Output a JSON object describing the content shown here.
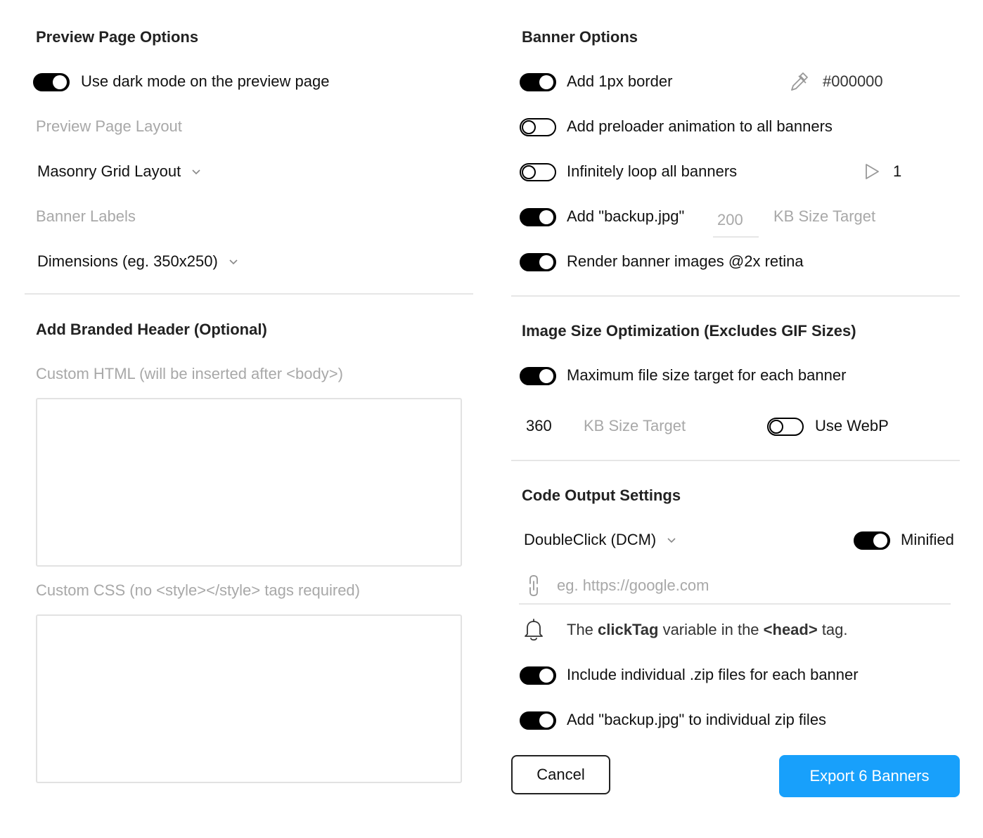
{
  "accent_color": "#18a0fb",
  "preview_page": {
    "title": "Preview Page Options",
    "dark_mode_label": "Use dark mode on the preview page",
    "dark_mode_on": true,
    "layout_label": "Preview Page Layout",
    "layout_value": "Masonry Grid Layout",
    "banner_labels_label": "Banner Labels",
    "banner_labels_value": "Dimensions (eg. 350x250)"
  },
  "branded_header": {
    "title": "Add Branded Header (Optional)",
    "html_label": "Custom HTML (will be inserted after <body>)",
    "css_label": "Custom CSS (no <style></style> tags required)"
  },
  "banner_options": {
    "title": "Banner Options",
    "border_label": "Add 1px border",
    "border_on": true,
    "border_color": "#000000",
    "eyedropper_icon": "eyedropper-icon",
    "preloader_label": "Add preloader animation to all banners",
    "preloader_on": false,
    "loop_label": "Infinitely loop all banners",
    "loop_on": false,
    "loop_count": "1",
    "play_icon": "play-icon",
    "backup_label": "Add \"backup.jpg\"",
    "backup_on": true,
    "backup_size_placeholder": "200",
    "backup_size_unit": "KB Size Target",
    "retina_label": "Render banner images @2x retina",
    "retina_on": true
  },
  "image_optimization": {
    "title": "Image Size Optimization (Excludes GIF Sizes)",
    "max_size_label": "Maximum file size target for each banner",
    "max_size_on": true,
    "size_value": "360",
    "size_unit": "KB Size Target",
    "webp_label": "Use WebP",
    "webp_on": false
  },
  "code_output": {
    "title": "Code Output Settings",
    "platform_value": "DoubleClick (DCM)",
    "minified_label": "Minified",
    "minified_on": true,
    "url_placeholder": "eg. https://google.com",
    "link_icon": "link-icon",
    "bell_icon": "bell-icon",
    "info_prefix": "The ",
    "info_clicktag": "clickTag",
    "info_middle": " variable in the ",
    "info_head": "<head>",
    "info_suffix": " tag.",
    "zip_label": "Include individual .zip files for each banner",
    "zip_on": true,
    "backup_zip_label": "Add \"backup.jpg\" to individual zip files",
    "backup_zip_on": true
  },
  "footer": {
    "cancel_label": "Cancel",
    "export_label": "Export 6 Banners"
  }
}
